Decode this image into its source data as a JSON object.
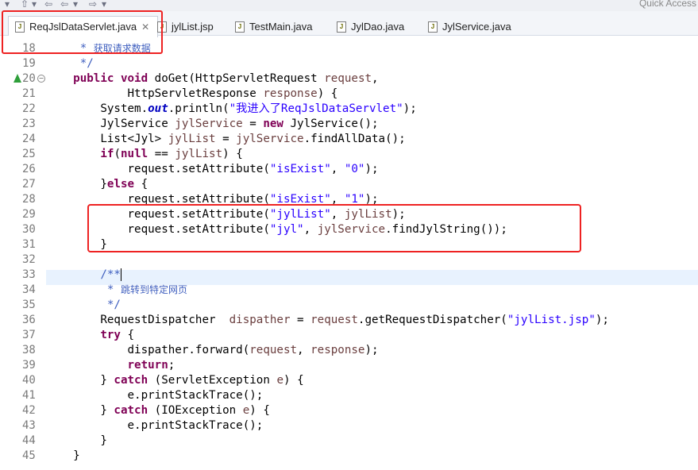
{
  "toolbar": {
    "quick_access": "Quick Access"
  },
  "tabs": [
    {
      "label": "ReqJslDataServlet.java",
      "active": true
    },
    {
      "label": "jylList.jsp"
    },
    {
      "label": "TestMain.java"
    },
    {
      "label": "JylDao.java"
    },
    {
      "label": "JylService.java"
    }
  ],
  "editor": {
    "lines": [
      {
        "num": "18",
        "text": "     * 获取请求数据"
      },
      {
        "num": "19",
        "text": "     */"
      },
      {
        "num": "20",
        "text": "    public void doGet(HttpServletRequest request,"
      },
      {
        "num": "21",
        "text": "            HttpServletResponse response) {"
      },
      {
        "num": "22",
        "text": "        System.out.println(\"我进入了ReqJslDataServlet\");"
      },
      {
        "num": "23",
        "text": "        JylService jylService = new JylService();"
      },
      {
        "num": "24",
        "text": "        List<Jyl> jylList = jylService.findAllData();"
      },
      {
        "num": "25",
        "text": "        if(null == jylList) {"
      },
      {
        "num": "26",
        "text": "            request.setAttribute(\"isExist\", \"0\");"
      },
      {
        "num": "27",
        "text": "        }else {"
      },
      {
        "num": "28",
        "text": "            request.setAttribute(\"isExist\", \"1\");"
      },
      {
        "num": "29",
        "text": "            request.setAttribute(\"jylList\", jylList);"
      },
      {
        "num": "30",
        "text": "            request.setAttribute(\"jyl\", jylService.findJylString());"
      },
      {
        "num": "31",
        "text": "        }"
      },
      {
        "num": "32",
        "text": ""
      },
      {
        "num": "33",
        "text": "        /**"
      },
      {
        "num": "34",
        "text": "         * 跳转到特定网页"
      },
      {
        "num": "35",
        "text": "         */"
      },
      {
        "num": "36",
        "text": "        RequestDispatcher  dispather = request.getRequestDispatcher(\"jylList.jsp\");"
      },
      {
        "num": "37",
        "text": "        try {"
      },
      {
        "num": "38",
        "text": "            dispather.forward(request, response);"
      },
      {
        "num": "39",
        "text": "            return;"
      },
      {
        "num": "40",
        "text": "        } catch (ServletException e) {"
      },
      {
        "num": "41",
        "text": "            e.printStackTrace();"
      },
      {
        "num": "42",
        "text": "        } catch (IOException e) {"
      },
      {
        "num": "43",
        "text": "            e.printStackTrace();"
      },
      {
        "num": "44",
        "text": "        }"
      },
      {
        "num": "45",
        "text": "    }"
      }
    ]
  },
  "colors": {
    "keyword": "#7f0055",
    "string": "#2a00ff",
    "comment": "#3f5fbf",
    "highlight_box": "#ee2222",
    "current_line": "#e8f2fe"
  },
  "icons": [
    "tab-java-file-icon",
    "tab-jsp-file-icon",
    "close-icon",
    "override-marker-icon",
    "fold-toggle-icon"
  ]
}
